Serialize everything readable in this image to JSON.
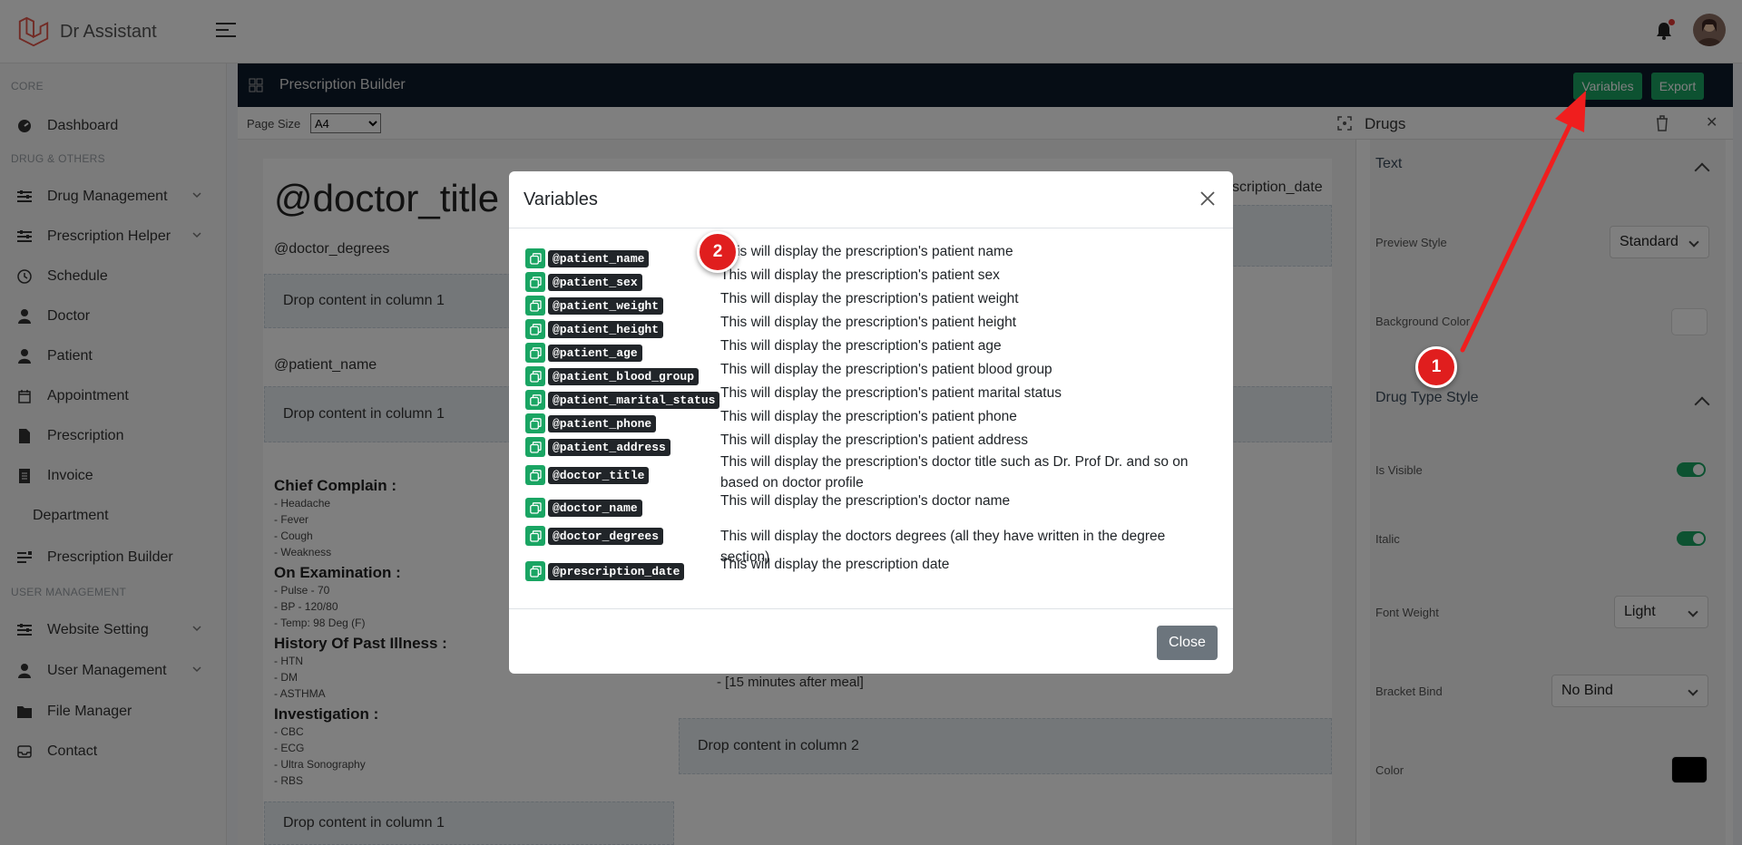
{
  "header": {
    "app_name": "Dr Assistant"
  },
  "sidebar": {
    "sections": [
      "CORE",
      "DRUG & OTHERS",
      "USER MANAGEMENT"
    ],
    "items": [
      {
        "label": "Dashboard",
        "icon": "dashboard-icon"
      },
      {
        "label": "Drug Management",
        "icon": "sliders-icon"
      },
      {
        "label": "Prescription Helper",
        "icon": "sliders-icon"
      },
      {
        "label": "Schedule",
        "icon": "clock-icon"
      },
      {
        "label": "Doctor",
        "icon": "user-icon"
      },
      {
        "label": "Patient",
        "icon": "user-icon"
      },
      {
        "label": "Appointment",
        "icon": "calendar-icon"
      },
      {
        "label": "Prescription",
        "icon": "file-icon"
      },
      {
        "label": "Invoice",
        "icon": "file-icon"
      },
      {
        "label": "Department",
        "icon": ""
      },
      {
        "label": "Prescription Builder",
        "icon": "builder-icon"
      },
      {
        "label": "Website Setting",
        "icon": "sliders-icon"
      },
      {
        "label": "User Management",
        "icon": "user-icon"
      },
      {
        "label": "File Manager",
        "icon": "folder-icon"
      },
      {
        "label": "Contact",
        "icon": "inbox-icon"
      }
    ]
  },
  "builder": {
    "title": "Prescription Builder",
    "variables_label": "Variables",
    "export_label": "Export",
    "page_size_label": "Page Size",
    "page_size_value": "A4",
    "doc_title": "@doctor_title @",
    "doc_degrees": "@doctor_degrees",
    "doc_date": "scription_date",
    "dropzone_col1": "Drop content in column 1",
    "dropzone_col2": "Drop content in column 2",
    "patient_name": "@patient_name",
    "rx_note": "- [15 minutes after meal]",
    "rx_sections": [
      {
        "heading": "Chief Complain :",
        "items": [
          "- Headache",
          "- Fever",
          "- Cough",
          "- Weakness"
        ]
      },
      {
        "heading": "On Examination :",
        "items": [
          "- Pulse - 70",
          "- BP - 120/80",
          "- Temp: 98 Deg (F)"
        ]
      },
      {
        "heading": "History Of Past Illness :",
        "items": [
          "- HTN",
          "- DM",
          "- ASTHMA"
        ]
      },
      {
        "heading": "Investigation :",
        "items": [
          "- CBC",
          "- ECG",
          "- Ultra Sonography",
          "- RBS"
        ]
      }
    ]
  },
  "right_panel": {
    "title": "Drugs",
    "text_section": "Text",
    "preview_style_label": "Preview Style",
    "preview_style_value": "Standard",
    "bg_color_label": "Background Color",
    "drug_type_section": "Drug Type Style",
    "is_visible_label": "Is Visible",
    "italic_label": "Italic",
    "font_weight_label": "Font Weight",
    "font_weight_value": "Light",
    "bracket_bind_label": "Bracket Bind",
    "bracket_bind_value": "No Bind",
    "color_label": "Color",
    "is_visible": true,
    "italic": true,
    "color_value": "#000000"
  },
  "modal": {
    "title": "Variables",
    "close_label": "Close",
    "variables": [
      {
        "tag": "@patient_name",
        "desc": "This will display the prescription's patient name"
      },
      {
        "tag": "@patient_sex",
        "desc": "This will display the prescription's patient sex"
      },
      {
        "tag": "@patient_weight",
        "desc": "This will display the prescription's patient weight"
      },
      {
        "tag": "@patient_height",
        "desc": "This will display the prescription's patient height"
      },
      {
        "tag": "@patient_age",
        "desc": "This will display the prescription's patient age"
      },
      {
        "tag": "@patient_blood_group",
        "desc": "This will display the prescription's patient blood group"
      },
      {
        "tag": "@patient_marital_status",
        "desc": "This will display the prescription's patient marital status"
      },
      {
        "tag": "@patient_phone",
        "desc": "This will display the prescription's patient phone"
      },
      {
        "tag": "@patient_address",
        "desc": "This will display the prescription's patient address"
      },
      {
        "tag": "@doctor_title",
        "desc": "This will display the prescription's doctor title such as Dr. Prof Dr. and so on based on doctor profile"
      },
      {
        "tag": "@doctor_name",
        "desc": "This will display the prescription's doctor name"
      },
      {
        "tag": "@doctor_degrees",
        "desc": "This will display the doctors degrees (all they have written in the degree section)"
      },
      {
        "tag": "@prescription_date",
        "desc": "This will display the prescription date"
      }
    ]
  },
  "annotations": {
    "step1": "1",
    "step2": "2"
  },
  "colors": {
    "accent_green": "#1aa563",
    "header_dark": "#0d1b2a",
    "annotation_red": "#e01e1e"
  }
}
